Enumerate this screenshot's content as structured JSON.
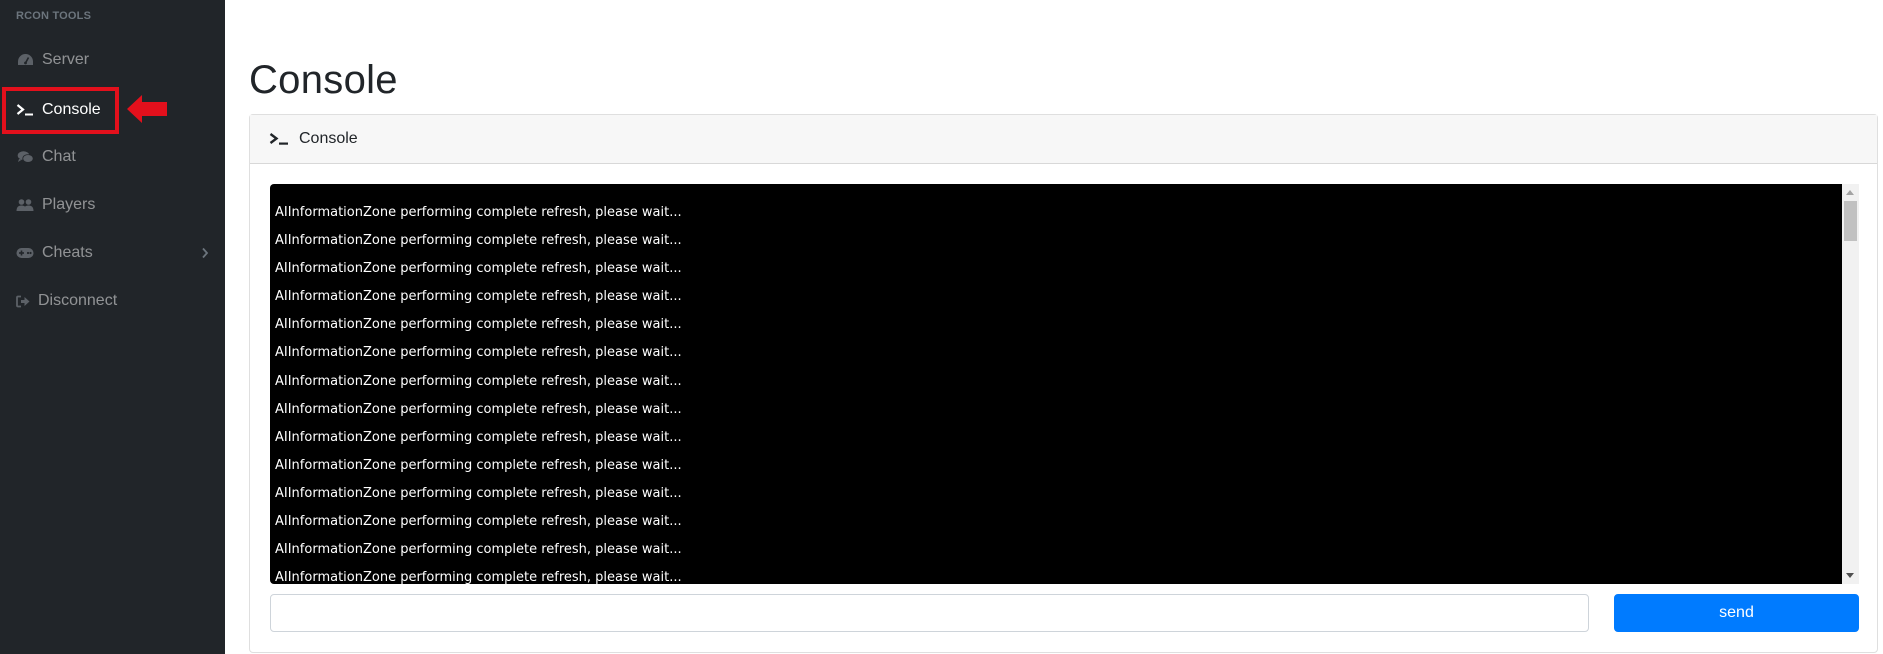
{
  "sidebar": {
    "heading": "RCON TOOLS",
    "items": [
      {
        "label": "Server",
        "icon": "tachometer-icon",
        "active": false
      },
      {
        "label": "Console",
        "icon": "terminal-icon",
        "active": true
      },
      {
        "label": "Chat",
        "icon": "comments-icon",
        "active": false
      },
      {
        "label": "Players",
        "icon": "users-icon",
        "active": false
      },
      {
        "label": "Cheats",
        "icon": "gamepad-icon",
        "active": false,
        "has_submenu": true
      },
      {
        "label": "Disconnect",
        "icon": "sign-out-icon",
        "active": false
      }
    ]
  },
  "annotation": {
    "highlight_color": "#e3101c",
    "arrow_direction": "left"
  },
  "main": {
    "title": "Console",
    "card": {
      "header_label": "Console",
      "header_icon": "terminal-icon",
      "console_lines": [
        "AIInformationZone performing complete refresh, please wait...",
        "AIInformationZone performing complete refresh, please wait...",
        "AIInformationZone performing complete refresh, please wait...",
        "AIInformationZone performing complete refresh, please wait...",
        "AIInformationZone performing complete refresh, please wait...",
        "AIInformationZone performing complete refresh, please wait...",
        "AIInformationZone performing complete refresh, please wait...",
        "AIInformationZone performing complete refresh, please wait...",
        "AIInformationZone performing complete refresh, please wait...",
        "AIInformationZone performing complete refresh, please wait...",
        "AIInformationZone performing complete refresh, please wait...",
        "AIInformationZone performing complete refresh, please wait...",
        "AIInformationZone performing complete refresh, please wait...",
        "AIInformationZone performing complete refresh, please wait..."
      ],
      "command_input": {
        "value": "",
        "placeholder": ""
      },
      "send_label": "send"
    }
  },
  "colors": {
    "sidebar_bg": "#212529",
    "primary": "#007bff",
    "terminal_bg": "#000000"
  }
}
